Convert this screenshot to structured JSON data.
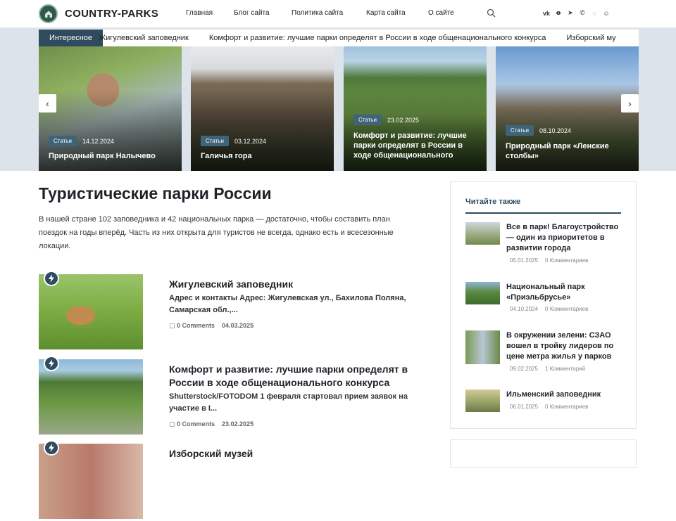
{
  "header": {
    "logo_text": "COUNTRY-PARKS",
    "nav": [
      "Главная",
      "Блог сайта",
      "Политика сайта",
      "Карта сайта",
      "О сайте"
    ],
    "social_icons": [
      "vk-icon",
      "ok-icon",
      "telegram-icon",
      "phone-icon",
      "whatsapp-icon",
      "profile-icon"
    ]
  },
  "ticker": {
    "label": "Интересное",
    "items": [
      "Жигулевский заповедник",
      "Комфорт и развитие: лучшие парки определят в России в ходе общенационального конкурса",
      "Изборский му"
    ]
  },
  "slider": [
    {
      "badge": "Статьи",
      "date": "14.12.2024",
      "title": "Природный парк Налычево"
    },
    {
      "badge": "Статьи",
      "date": "03.12.2024",
      "title": "Галичья гора"
    },
    {
      "badge": "Статьи",
      "date": "23.02.2025",
      "title": "Комфорт и развитие: лучшие парки определят в России в ходе общенационального"
    },
    {
      "badge": "Статьи",
      "date": "08.10.2024",
      "title": "Природный парк «Ленские столбы»"
    }
  ],
  "main": {
    "title": "Туристические парки России",
    "intro": "В нашей стране 102 заповедника и 42 национальных парка — достаточно, чтобы составить план поездок на годы вперёд. Часть из них открыта для туристов не всегда, однако есть и всесезонные локации.",
    "posts": [
      {
        "title": "Жигулевский заповедник",
        "excerpt": "Адрес и контакты Адрес: Жигулевская ул., Бахилова Поляна, Самарская обл.,...",
        "comments": "0 Comments",
        "date": "04.03.2025"
      },
      {
        "title": "Комфорт и развитие: лучшие парки определят в России в ходе общенационального конкурса",
        "excerpt": "Shutterstock/FOTODOM 1 февраля стартовал прием заявок на участие в I...",
        "comments": "0 Comments",
        "date": "23.02.2025"
      },
      {
        "title": "Изборский музей",
        "excerpt": "",
        "comments": "",
        "date": ""
      }
    ]
  },
  "sidebar": {
    "title": "Читайте также",
    "items": [
      {
        "title": "Все в парк! Благоустройство — один из приоритетов в развитии города",
        "date": "05.01.2025",
        "comments": "0 Комментариев"
      },
      {
        "title": "Национальный парк «Приэльбрусье»",
        "date": "04.10.2024",
        "comments": "0 Комментариев"
      },
      {
        "title": "В окружении зелени: СЗАО вошел в тройку лидеров по цене метра жилья у парков",
        "date": "09.02.2025",
        "comments": "1 Комментарий"
      },
      {
        "title": "Ильменский заповедник",
        "date": "06.01.2025",
        "comments": "0 Комментариев"
      }
    ]
  }
}
